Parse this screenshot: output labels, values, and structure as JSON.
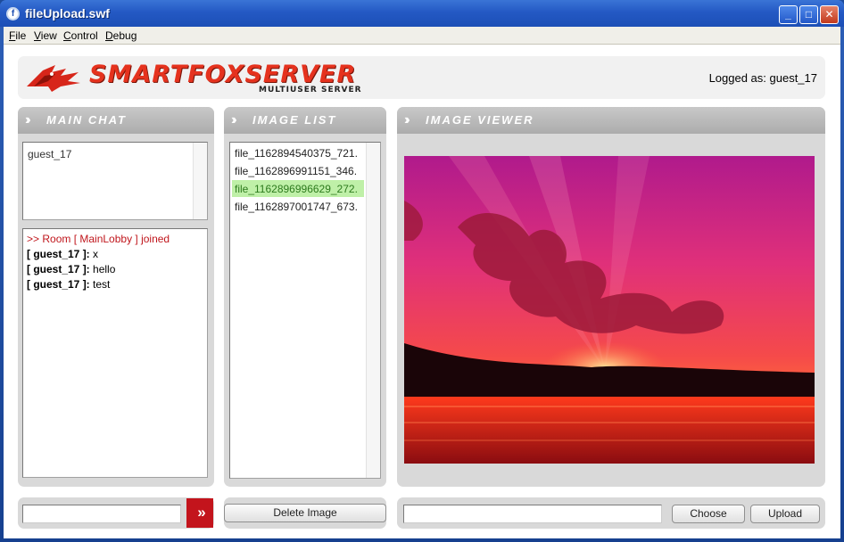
{
  "window": {
    "title": "fileUpload.swf",
    "min": "_",
    "max": "□",
    "close": "✕"
  },
  "menu": [
    "File",
    "View",
    "Control",
    "Debug"
  ],
  "header": {
    "logo_text": "SMARTFOXSERVER",
    "logo_sub": "MULTIUSER SERVER",
    "logged_as": "Logged as: guest_17"
  },
  "main_chat": {
    "title": "MAIN CHAT",
    "users": [
      "guest_17"
    ],
    "messages": {
      "system": ">> Room [ MainLobby ] joined",
      "m1_user": "[ guest_17 ]:",
      "m1_text": " x",
      "m2_user": "[ guest_17 ]:",
      "m2_text": " hello",
      "m3_user": "[ guest_17 ]:",
      "m3_text": " test"
    },
    "input_value": "",
    "send_label": "»"
  },
  "image_list": {
    "title": "IMAGE LIST",
    "items": [
      "file_1162894540375_721.",
      "file_1162896991151_346.",
      "file_1162896996629_272.",
      "file_1162897001747_673."
    ],
    "selected_index": 2,
    "delete_label": "Delete Image"
  },
  "image_viewer": {
    "title": "IMAGE VIEWER",
    "file_input_value": "",
    "choose_label": "Choose",
    "upload_label": "Upload"
  },
  "colors": {
    "accent_red": "#c3141c",
    "panel_gray": "#d9d9d9",
    "selected_row": "#bff0a8"
  }
}
